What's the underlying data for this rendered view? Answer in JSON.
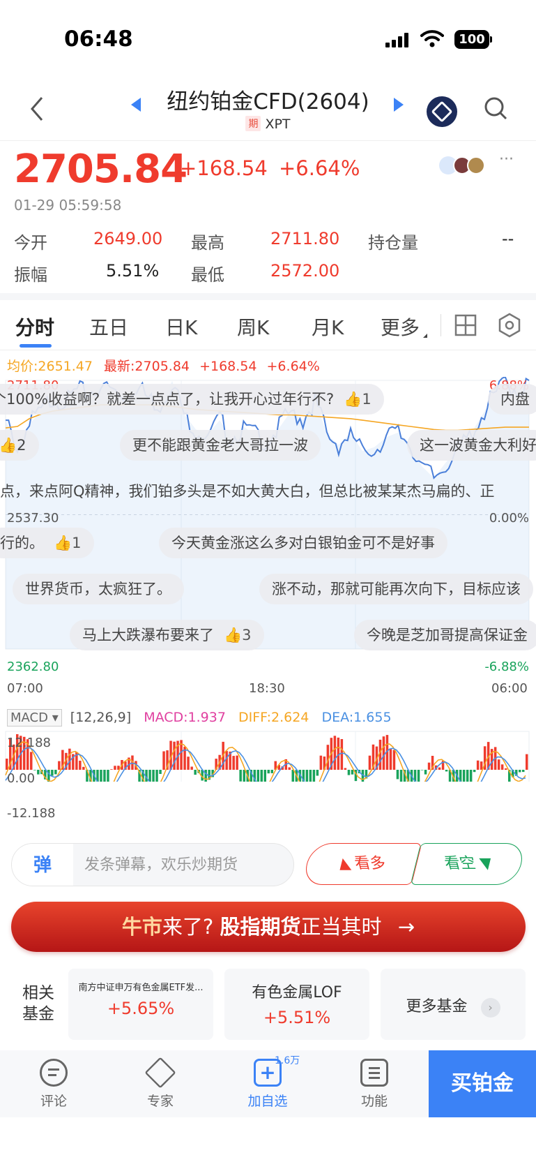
{
  "status": {
    "time": "06:48",
    "battery": "100"
  },
  "nav": {
    "title": "纽约铂金CFD(2604)",
    "tag": "期",
    "code": "XPT"
  },
  "quote": {
    "price": "2705.84",
    "change": "+168.54",
    "change_pct": "+6.64%",
    "timestamp": "01-29 05:59:58",
    "open_label": "今开",
    "open": "2649.00",
    "high_label": "最高",
    "high": "2711.80",
    "oi_label": "持仓量",
    "oi": "--",
    "amp_label": "振幅",
    "amp": "5.51%",
    "low_label": "最低",
    "low": "2572.00"
  },
  "tabs": [
    "分时",
    "五日",
    "日K",
    "周K",
    "月K",
    "更多"
  ],
  "chart_info": {
    "avg": "均价:2651.47",
    "last": "最新:2705.84",
    "chg": "+168.54",
    "pct": "+6.64%"
  },
  "chart_axis": {
    "ymax": "2711.80",
    "ymax_pct": "6.88%",
    "ymid": "2537.30",
    "ymid_pct": "0.00%",
    "ymin": "2362.80",
    "ymin_pct": "-6.88%",
    "x0": "07:00",
    "x1": "18:30",
    "x2": "06:00"
  },
  "danmaku": [
    {
      "text": "个100%收益啊？就差一点点了，让我开心过年行不?",
      "likes": "1"
    },
    {
      "text": "内盘",
      "likes": ""
    },
    {
      "text": "2",
      "likes": ""
    },
    {
      "text": "更不能跟黄金老大哥拉一波",
      "likes": ""
    },
    {
      "text": "这一波黄金大利好",
      "likes": ""
    },
    {
      "text": "点，来点阿Q精神，我们铂多头是不如大黄大白，但总比被某某杰马扁的、正",
      "likes": ""
    },
    {
      "text": "行的。",
      "likes": "1"
    },
    {
      "text": "今天黄金涨这么多对白银铂金可不是好事",
      "likes": ""
    },
    {
      "text": "世界货币，太疯狂了。",
      "likes": ""
    },
    {
      "text": "涨不动，那就可能再次向下，目标应该",
      "likes": ""
    },
    {
      "text": "马上大跌瀑布要来了",
      "likes": "3"
    },
    {
      "text": "今晚是芝加哥提高保证金",
      "likes": ""
    }
  ],
  "macd": {
    "selector": "MACD",
    "params": "[12,26,9]",
    "macd": "MACD:1.937",
    "diff": "DIFF:2.624",
    "dea": "DEA:1.655",
    "ymax": "12.188",
    "zero": "0.00",
    "ymin": "-12.188"
  },
  "toolbar": {
    "danmaku_icon": "弹",
    "danmaku_placeholder": "发条弹幕，欢乐炒期货",
    "long": "看多",
    "short": "看空"
  },
  "banner": {
    "part1": "牛市",
    "part2": "来了?",
    "part3": "股指期货",
    "part4": "正当其时"
  },
  "funds": {
    "label": "相关基金",
    "items": [
      {
        "name": "南方中证申万有色金属ETF发...",
        "pct": "+5.65%"
      },
      {
        "name": "有色金属LOF",
        "pct": "+5.51%"
      }
    ],
    "more": "更多基金"
  },
  "tabbar": {
    "comment": "评论",
    "expert": "专家",
    "watch": "加自选",
    "watch_count": "1.6万",
    "func": "功能",
    "buy": "买铂金"
  },
  "colors": {
    "red": "#ef3b2d",
    "green": "#19a35b",
    "blue": "#3b82f6",
    "orange": "#f5a623"
  },
  "chart_data": {
    "type": "line",
    "title": "",
    "x_ticks": [
      "07:00",
      "18:30",
      "06:00"
    ],
    "ylim": [
      2362.8,
      2711.8
    ],
    "series": [
      {
        "name": "",
        "values": [
          2660,
          2625,
          2655,
          2672,
          2690,
          2685,
          2698,
          2695,
          2705,
          2700,
          2692,
          2706,
          2688,
          2680,
          2711,
          2668,
          2648,
          2642,
          2660,
          2635,
          2652,
          2640,
          2633,
          2650,
          2672,
          2660,
          2688,
          2642,
          2628,
          2643,
          2620,
          2625,
          2638,
          2644,
          2630,
          2600,
          2585,
          2605,
          2620,
          2640,
          2665,
          2690,
          2708,
          2700,
          2705
        ]
      },
      {
        "name": "均价",
        "values": [
          2650,
          2652,
          2662,
          2668,
          2672,
          2674,
          2676,
          2678,
          2680,
          2680,
          2680,
          2680,
          2680,
          2679,
          2678,
          2676,
          2674,
          2673,
          2672,
          2671,
          2670,
          2669,
          2668,
          2667,
          2667,
          2666,
          2665,
          2664,
          2663,
          2662,
          2660,
          2658,
          2656,
          2654,
          2652,
          2650,
          2648,
          2647,
          2647,
          2648,
          2649,
          2650,
          2651,
          2651,
          2651
        ]
      }
    ],
    "macd_ylim": [
      -12.188,
      12.188
    ]
  }
}
